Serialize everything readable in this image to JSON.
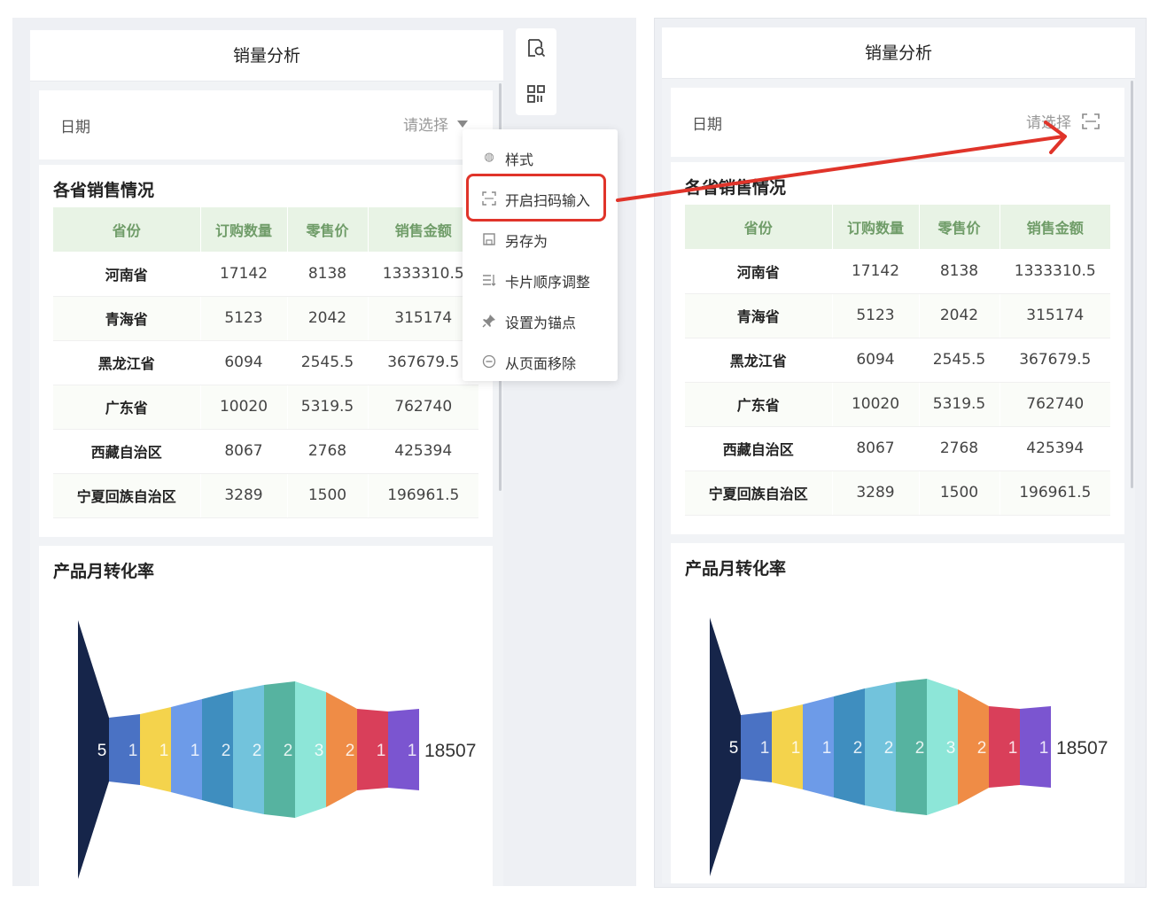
{
  "left": {
    "header_title": "销量分析",
    "date_label": "日期",
    "date_placeholder": "请选择",
    "table_title": "各省销售情况",
    "columns": [
      "省份",
      "订购数量",
      "零售价",
      "销售金额"
    ],
    "rows": [
      [
        "河南省",
        "17142",
        "8138",
        "1333310.5"
      ],
      [
        "青海省",
        "5123",
        "2042",
        "315174"
      ],
      [
        "黑龙江省",
        "6094",
        "2545.5",
        "367679.5"
      ],
      [
        "广东省",
        "10020",
        "5319.5",
        "762740"
      ],
      [
        "西藏自治区",
        "8067",
        "2768",
        "425394"
      ],
      [
        "宁夏回族自治区",
        "3289",
        "1500",
        "196961.5"
      ]
    ],
    "funnel_title": "产品月转化率",
    "menu": [
      {
        "icon": "palette-icon",
        "label": "样式"
      },
      {
        "icon": "scan-icon",
        "label": "开启扫码输入"
      },
      {
        "icon": "save-icon",
        "label": "另存为"
      },
      {
        "icon": "sort-icon",
        "label": "卡片顺序调整"
      },
      {
        "icon": "pin-icon",
        "label": "设置为锚点"
      },
      {
        "icon": "remove-icon",
        "label": "从页面移除"
      }
    ]
  },
  "right": {
    "header_title": "销量分析",
    "date_label": "日期",
    "date_placeholder": "请选择",
    "table_title": "各省销售情况",
    "columns": [
      "省份",
      "订购数量",
      "零售价",
      "销售金额"
    ],
    "rows": [
      [
        "河南省",
        "17142",
        "8138",
        "1333310.5"
      ],
      [
        "青海省",
        "5123",
        "2042",
        "315174"
      ],
      [
        "黑龙江省",
        "6094",
        "2545.5",
        "367679.5"
      ],
      [
        "广东省",
        "10020",
        "5319.5",
        "762740"
      ],
      [
        "西藏自治区",
        "8067",
        "2768",
        "425394"
      ],
      [
        "宁夏回族自治区",
        "3289",
        "1500",
        "196961.5"
      ]
    ],
    "funnel_title": "产品月转化率"
  },
  "funnel": {
    "labels": [
      "5",
      "1",
      "1",
      "1",
      "2",
      "2",
      "2",
      "3",
      "2",
      "1",
      "1"
    ],
    "end_label": "18507",
    "colors": [
      "#16254a",
      "#4a72c4",
      "#f4d34c",
      "#6d9be8",
      "#3f8ebf",
      "#72c3dc",
      "#56b3a0",
      "#8de6d8",
      "#ef8c46",
      "#d93f5a",
      "#7b55d0"
    ]
  },
  "colors": {
    "highlight": "#e0342a",
    "header_green": "#e8f3e5",
    "header_green_text": "#6f9c68"
  }
}
